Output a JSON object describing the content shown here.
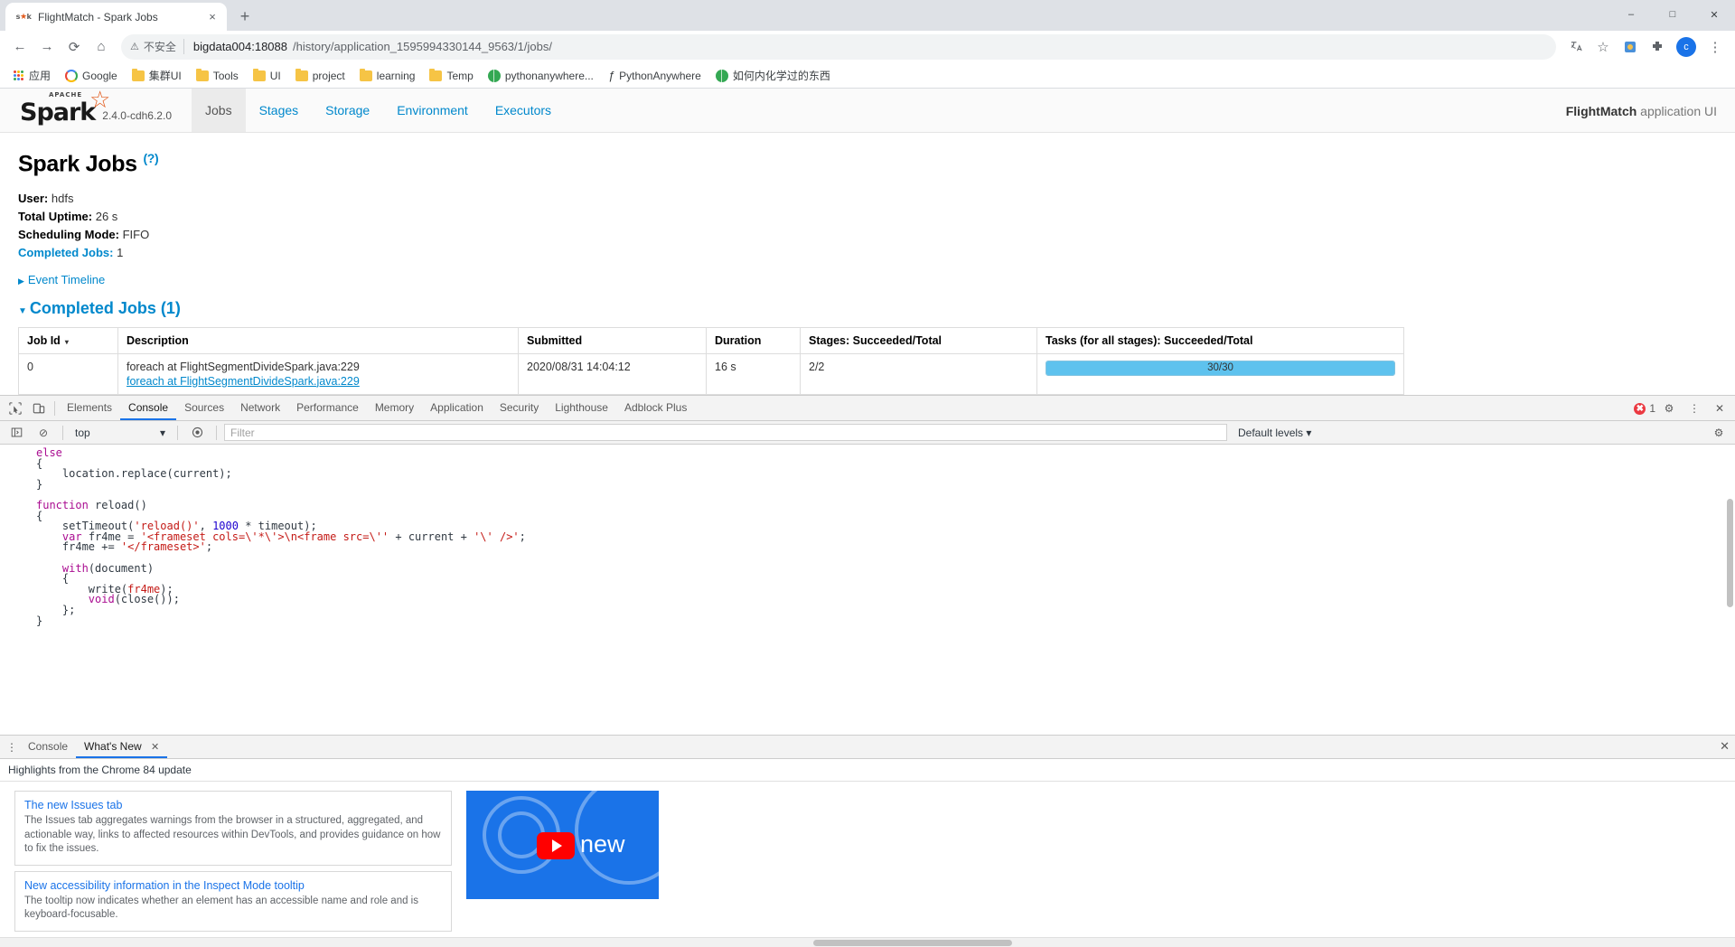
{
  "browser": {
    "tab": {
      "title": "FlightMatch - Spark Jobs",
      "favicon": "spark-favicon",
      "close": "×"
    },
    "new_tab_label": "+",
    "window_controls": {
      "minimize": "–",
      "maximize": "□",
      "close": "✕"
    },
    "nav": {
      "back": "←",
      "forward": "→",
      "reload": "⟳",
      "home": "⌂"
    },
    "omnibox": {
      "security_label": "不安全",
      "warning_icon": "⚠",
      "url_host": "bigdata004:18088",
      "url_path": "/history/application_1595994330144_9563/1/jobs/"
    },
    "toolbar_right": {
      "translate": "translate-icon",
      "bookmark_star": "☆",
      "extension_1": "extension-puzzle-icon",
      "extension_2": "extensions-icon",
      "profile_initial": "c",
      "menu": "⋮"
    },
    "bookmarks": [
      {
        "label": "应用",
        "icon": "apps-grid-icon"
      },
      {
        "label": "Google",
        "icon": "google-icon"
      },
      {
        "label": "集群UI",
        "icon": "folder-icon"
      },
      {
        "label": "Tools",
        "icon": "folder-icon"
      },
      {
        "label": "UI",
        "icon": "folder-icon"
      },
      {
        "label": "project",
        "icon": "folder-icon"
      },
      {
        "label": "learning",
        "icon": "folder-icon"
      },
      {
        "label": "Temp",
        "icon": "folder-icon"
      },
      {
        "label": "pythonanywhere...",
        "icon": "globe-icon"
      },
      {
        "label": "PythonAnywhere",
        "icon": "python-icon"
      },
      {
        "label": "如何内化学过的东西",
        "icon": "globe-icon"
      }
    ]
  },
  "spark": {
    "brand": {
      "name": "Spark",
      "apache": "APACHE",
      "version": "2.4.0-cdh6.2.0"
    },
    "tabs": [
      {
        "label": "Jobs",
        "active": true
      },
      {
        "label": "Stages",
        "active": false
      },
      {
        "label": "Storage",
        "active": false
      },
      {
        "label": "Environment",
        "active": false
      },
      {
        "label": "Executors",
        "active": false
      }
    ],
    "app_name": "FlightMatch",
    "app_suffix": "application UI",
    "page_title": "Spark Jobs",
    "help_marker": "(?)",
    "meta": [
      {
        "label": "User:",
        "value": "hdfs",
        "link": false
      },
      {
        "label": "Total Uptime:",
        "value": "26 s",
        "link": false
      },
      {
        "label": "Scheduling Mode:",
        "value": "FIFO",
        "link": false
      },
      {
        "label": "Completed Jobs:",
        "value": "1",
        "link": true
      }
    ],
    "event_timeline": {
      "label": "Event Timeline",
      "caret": "▶"
    },
    "completed_section": {
      "label": "Completed Jobs (1)",
      "caret": "▼"
    },
    "table": {
      "columns": [
        "Job Id",
        "Description",
        "Submitted",
        "Duration",
        "Stages: Succeeded/Total",
        "Tasks (for all stages): Succeeded/Total"
      ],
      "sort_caret": "▾",
      "rows": [
        {
          "job_id": "0",
          "description": "foreach at FlightSegmentDivideSpark.java:229",
          "description_link": "foreach at FlightSegmentDivideSpark.java:229",
          "submitted": "2020/08/31 14:04:12",
          "duration": "16 s",
          "stages": "2/2",
          "tasks_label": "30/30",
          "tasks_percent": 100
        }
      ]
    }
  },
  "devtools": {
    "icons": {
      "inspect": "inspect-element-icon",
      "device": "device-toolbar-icon",
      "settings": "⚙",
      "more": "⋮",
      "close": "✕"
    },
    "tabs": [
      {
        "label": "Elements",
        "active": false
      },
      {
        "label": "Console",
        "active": true
      },
      {
        "label": "Sources",
        "active": false
      },
      {
        "label": "Network",
        "active": false
      },
      {
        "label": "Performance",
        "active": false
      },
      {
        "label": "Memory",
        "active": false
      },
      {
        "label": "Application",
        "active": false
      },
      {
        "label": "Security",
        "active": false
      },
      {
        "label": "Lighthouse",
        "active": false
      },
      {
        "label": "Adblock Plus",
        "active": false
      }
    ],
    "error_count": "1",
    "filterbar": {
      "sidebar_toggle": "console-sidebar-icon",
      "clear": "⊘",
      "context": "top",
      "context_caret": "▾",
      "eye": "live-expression-icon",
      "filter_placeholder": "Filter",
      "levels": "Default levels",
      "levels_caret": "▾",
      "settings": "⚙"
    },
    "console_lines": [
      {
        "indent": 0,
        "segments": [
          {
            "t": "else",
            "c": "kw-p"
          }
        ]
      },
      {
        "indent": 0,
        "segments": [
          {
            "t": "{",
            "c": ""
          }
        ]
      },
      {
        "indent": 1,
        "segments": [
          {
            "t": "location.replace(current);",
            "c": ""
          }
        ]
      },
      {
        "indent": 0,
        "segments": [
          {
            "t": "}",
            "c": ""
          }
        ]
      },
      {
        "indent": 0,
        "segments": [
          {
            "t": "",
            "c": ""
          }
        ]
      },
      {
        "indent": 0,
        "segments": [
          {
            "t": "function ",
            "c": "kw-p"
          },
          {
            "t": "reload",
            "c": ""
          },
          {
            "t": "()",
            "c": ""
          }
        ]
      },
      {
        "indent": 0,
        "segments": [
          {
            "t": "{",
            "c": ""
          }
        ]
      },
      {
        "indent": 1,
        "segments": [
          {
            "t": "setTimeout(",
            "c": ""
          },
          {
            "t": "'reload()'",
            "c": "str"
          },
          {
            "t": ", ",
            "c": ""
          },
          {
            "t": "1000",
            "c": "num"
          },
          {
            "t": " * timeout);",
            "c": ""
          }
        ]
      },
      {
        "indent": 1,
        "segments": [
          {
            "t": "var ",
            "c": "kw-p"
          },
          {
            "t": "fr4me = ",
            "c": ""
          },
          {
            "t": "'<frameset cols=\\'*\\'>\\n<frame src=\\'' ",
            "c": "str"
          },
          {
            "t": "+ current + ",
            "c": ""
          },
          {
            "t": "'\\' />'",
            "c": "str"
          },
          {
            "t": ";",
            "c": ""
          }
        ]
      },
      {
        "indent": 1,
        "segments": [
          {
            "t": "fr4me += ",
            "c": ""
          },
          {
            "t": "'</frameset>'",
            "c": "str"
          },
          {
            "t": ";",
            "c": ""
          }
        ]
      },
      {
        "indent": 0,
        "segments": [
          {
            "t": "",
            "c": ""
          }
        ]
      },
      {
        "indent": 1,
        "segments": [
          {
            "t": "with",
            "c": "kw-p"
          },
          {
            "t": "(document)",
            "c": ""
          }
        ]
      },
      {
        "indent": 1,
        "segments": [
          {
            "t": "{",
            "c": ""
          }
        ]
      },
      {
        "indent": 2,
        "segments": [
          {
            "t": "write(",
            "c": ""
          },
          {
            "t": "fr4me",
            "c": "str"
          },
          {
            "t": ");",
            "c": ""
          }
        ]
      },
      {
        "indent": 2,
        "segments": [
          {
            "t": "void",
            "c": "kw-p"
          },
          {
            "t": "(close());",
            "c": ""
          }
        ]
      },
      {
        "indent": 1,
        "segments": [
          {
            "t": "};",
            "c": ""
          }
        ]
      },
      {
        "indent": 0,
        "segments": [
          {
            "t": "}",
            "c": ""
          }
        ]
      }
    ],
    "drawer": {
      "tabs": [
        {
          "label": "Console",
          "active": false,
          "closable": false
        },
        {
          "label": "What's New",
          "active": true,
          "closable": true,
          "close": "✕"
        }
      ],
      "close": "✕",
      "subtitle": "Highlights from the Chrome 84 update",
      "cards": [
        {
          "title": "The new Issues tab",
          "text": "The Issues tab aggregates warnings from the browser in a structured, aggregated, and actionable way, links to affected resources within DevTools, and provides guidance on how to fix the issues."
        },
        {
          "title": "New accessibility information in the Inspect Mode tooltip",
          "text": "The tooltip now indicates whether an element has an accessible name and role and is keyboard-focusable."
        }
      ],
      "video": {
        "label": "new",
        "play_icon": "youtube-play-icon"
      }
    }
  }
}
